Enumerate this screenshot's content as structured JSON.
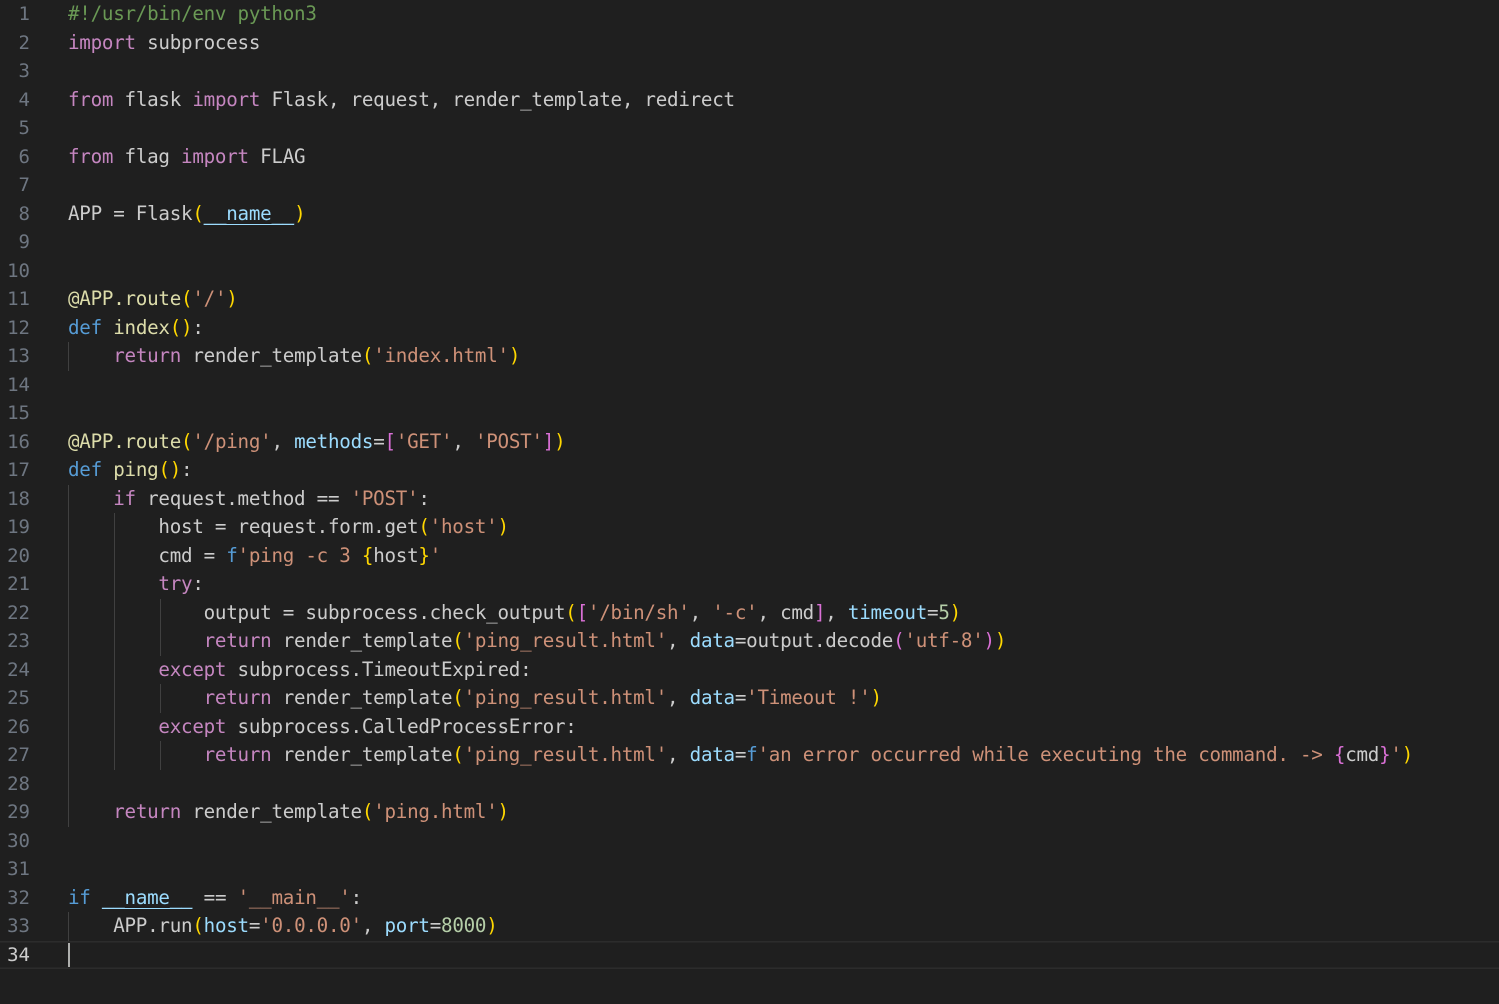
{
  "editor": {
    "language": "python",
    "cursor_line": 34,
    "theme_colors": {
      "background": "#1f1f1f",
      "default_text": "#cccccc",
      "line_number": "#6e7681",
      "comment": "#6a9955",
      "keyword_control": "#c586c0",
      "keyword": "#569cd6",
      "string": "#ce9178",
      "function": "#dcdcaa",
      "variable": "#9cdcfe",
      "number": "#b5cea8",
      "bracket_level_1": "#ffd700",
      "bracket_level_2": "#da70d6",
      "bracket_level_3": "#179fff"
    },
    "lines": [
      {
        "n": "1",
        "indent": 0,
        "tokens": [
          [
            "#!/usr/bin/env python3",
            "cmt"
          ]
        ]
      },
      {
        "n": "2",
        "indent": 0,
        "tokens": [
          [
            "import",
            "kw"
          ],
          [
            " subprocess",
            ""
          ]
        ]
      },
      {
        "n": "3",
        "indent": 0,
        "tokens": []
      },
      {
        "n": "4",
        "indent": 0,
        "tokens": [
          [
            "from",
            "kw"
          ],
          [
            " flask ",
            ""
          ],
          [
            "import",
            "kw"
          ],
          [
            " Flask, request, render_template, redirect",
            ""
          ]
        ]
      },
      {
        "n": "5",
        "indent": 0,
        "tokens": []
      },
      {
        "n": "6",
        "indent": 0,
        "tokens": [
          [
            "from",
            "kw"
          ],
          [
            " flag ",
            ""
          ],
          [
            "import",
            "kw"
          ],
          [
            " FLAG",
            ""
          ]
        ]
      },
      {
        "n": "7",
        "indent": 0,
        "tokens": []
      },
      {
        "n": "8",
        "indent": 0,
        "tokens": [
          [
            "APP = Flask",
            ""
          ],
          [
            "(",
            "b1"
          ],
          [
            "__name__",
            "var ul"
          ],
          [
            ")",
            "b1"
          ]
        ]
      },
      {
        "n": "9",
        "indent": 0,
        "tokens": []
      },
      {
        "n": "10",
        "indent": 0,
        "tokens": []
      },
      {
        "n": "11",
        "indent": 0,
        "tokens": [
          [
            "@APP.route",
            "fn"
          ],
          [
            "(",
            "b1"
          ],
          [
            "'/'",
            "str"
          ],
          [
            ")",
            "b1"
          ]
        ]
      },
      {
        "n": "12",
        "indent": 0,
        "tokens": [
          [
            "def",
            "kwb"
          ],
          [
            " ",
            ""
          ],
          [
            "index",
            "fn"
          ],
          [
            "()",
            "b1"
          ],
          [
            ":",
            ""
          ]
        ]
      },
      {
        "n": "13",
        "indent": 1,
        "tokens": [
          [
            "    ",
            ""
          ],
          [
            "return",
            "kw"
          ],
          [
            " render_template",
            ""
          ],
          [
            "(",
            "b1"
          ],
          [
            "'index.html'",
            "str"
          ],
          [
            ")",
            "b1"
          ]
        ]
      },
      {
        "n": "14",
        "indent": 0,
        "tokens": []
      },
      {
        "n": "15",
        "indent": 0,
        "tokens": []
      },
      {
        "n": "16",
        "indent": 0,
        "tokens": [
          [
            "@APP.route",
            "fn"
          ],
          [
            "(",
            "b1"
          ],
          [
            "'/ping'",
            "str"
          ],
          [
            ", ",
            ""
          ],
          [
            "methods",
            "var"
          ],
          [
            "=",
            ""
          ],
          [
            "[",
            "b2"
          ],
          [
            "'GET'",
            "str"
          ],
          [
            ", ",
            ""
          ],
          [
            "'POST'",
            "str"
          ],
          [
            "]",
            "b2"
          ],
          [
            ")",
            "b1"
          ]
        ]
      },
      {
        "n": "17",
        "indent": 0,
        "tokens": [
          [
            "def",
            "kwb"
          ],
          [
            " ",
            ""
          ],
          [
            "ping",
            "fn"
          ],
          [
            "()",
            "b1"
          ],
          [
            ":",
            ""
          ]
        ]
      },
      {
        "n": "18",
        "indent": 1,
        "tokens": [
          [
            "    ",
            ""
          ],
          [
            "if",
            "kw"
          ],
          [
            " request.method == ",
            ""
          ],
          [
            "'POST'",
            "str"
          ],
          [
            ":",
            ""
          ]
        ]
      },
      {
        "n": "19",
        "indent": 2,
        "tokens": [
          [
            "        host = request.form.get",
            ""
          ],
          [
            "(",
            "b1"
          ],
          [
            "'host'",
            "str"
          ],
          [
            ")",
            "b1"
          ]
        ]
      },
      {
        "n": "20",
        "indent": 2,
        "tokens": [
          [
            "        cmd = ",
            ""
          ],
          [
            "f",
            "kwb"
          ],
          [
            "'ping -c 3 ",
            "str"
          ],
          [
            "{",
            "b1"
          ],
          [
            "host",
            ""
          ],
          [
            "}",
            "b1"
          ],
          [
            "'",
            "str"
          ]
        ]
      },
      {
        "n": "21",
        "indent": 2,
        "tokens": [
          [
            "        ",
            ""
          ],
          [
            "try",
            "kw"
          ],
          [
            ":",
            ""
          ]
        ]
      },
      {
        "n": "22",
        "indent": 3,
        "tokens": [
          [
            "            output = subprocess.check_output",
            ""
          ],
          [
            "(",
            "b1"
          ],
          [
            "[",
            "b2"
          ],
          [
            "'/bin/sh'",
            "str"
          ],
          [
            ", ",
            ""
          ],
          [
            "'-c'",
            "str"
          ],
          [
            ", cmd",
            ""
          ],
          [
            "]",
            "b2"
          ],
          [
            ", ",
            ""
          ],
          [
            "timeout",
            "var"
          ],
          [
            "=",
            ""
          ],
          [
            "5",
            "num"
          ],
          [
            ")",
            "b1"
          ]
        ]
      },
      {
        "n": "23",
        "indent": 3,
        "tokens": [
          [
            "            ",
            ""
          ],
          [
            "return",
            "kw"
          ],
          [
            " render_template",
            ""
          ],
          [
            "(",
            "b1"
          ],
          [
            "'ping_result.html'",
            "str"
          ],
          [
            ", ",
            ""
          ],
          [
            "data",
            "var"
          ],
          [
            "=output.decode",
            ""
          ],
          [
            "(",
            "b2"
          ],
          [
            "'utf-8'",
            "str"
          ],
          [
            ")",
            "b2"
          ],
          [
            ")",
            "b1"
          ]
        ]
      },
      {
        "n": "24",
        "indent": 2,
        "tokens": [
          [
            "        ",
            ""
          ],
          [
            "except",
            "kw"
          ],
          [
            " subprocess.TimeoutExpired:",
            ""
          ]
        ]
      },
      {
        "n": "25",
        "indent": 3,
        "tokens": [
          [
            "            ",
            ""
          ],
          [
            "return",
            "kw"
          ],
          [
            " render_template",
            ""
          ],
          [
            "(",
            "b1"
          ],
          [
            "'ping_result.html'",
            "str"
          ],
          [
            ", ",
            ""
          ],
          [
            "data",
            "var"
          ],
          [
            "=",
            ""
          ],
          [
            "'Timeout !'",
            "str"
          ],
          [
            ")",
            "b1"
          ]
        ]
      },
      {
        "n": "26",
        "indent": 2,
        "tokens": [
          [
            "        ",
            ""
          ],
          [
            "except",
            "kw"
          ],
          [
            " subprocess.CalledProcessError:",
            ""
          ]
        ]
      },
      {
        "n": "27",
        "indent": 3,
        "tokens": [
          [
            "            ",
            ""
          ],
          [
            "return",
            "kw"
          ],
          [
            " render_template",
            ""
          ],
          [
            "(",
            "b1"
          ],
          [
            "'ping_result.html'",
            "str"
          ],
          [
            ", ",
            ""
          ],
          [
            "data",
            "var"
          ],
          [
            "=",
            ""
          ],
          [
            "f",
            "kwb"
          ],
          [
            "'an error occurred while executing the command. -> ",
            "str"
          ],
          [
            "{",
            "b2"
          ],
          [
            "cmd",
            ""
          ],
          [
            "}",
            "b2"
          ],
          [
            "'",
            "str"
          ],
          [
            ")",
            "b1"
          ]
        ]
      },
      {
        "n": "28",
        "indent": 1,
        "tokens": []
      },
      {
        "n": "29",
        "indent": 1,
        "tokens": [
          [
            "    ",
            ""
          ],
          [
            "return",
            "kw"
          ],
          [
            " render_template",
            ""
          ],
          [
            "(",
            "b1"
          ],
          [
            "'ping.html'",
            "str"
          ],
          [
            ")",
            "b1"
          ]
        ]
      },
      {
        "n": "30",
        "indent": 0,
        "tokens": []
      },
      {
        "n": "31",
        "indent": 0,
        "tokens": []
      },
      {
        "n": "32",
        "indent": 0,
        "tokens": [
          [
            "if",
            "kwb"
          ],
          [
            " ",
            ""
          ],
          [
            "__name__",
            "var ul"
          ],
          [
            " == ",
            ""
          ],
          [
            "'__main__'",
            "str"
          ],
          [
            ":",
            ""
          ]
        ]
      },
      {
        "n": "33",
        "indent": 1,
        "tokens": [
          [
            "    APP.run",
            ""
          ],
          [
            "(",
            "b1"
          ],
          [
            "host",
            "var"
          ],
          [
            "=",
            ""
          ],
          [
            "'0.0.0.0'",
            "str"
          ],
          [
            ", ",
            ""
          ],
          [
            "port",
            "var"
          ],
          [
            "=",
            ""
          ],
          [
            "8000",
            "num"
          ],
          [
            ")",
            "b1"
          ]
        ]
      },
      {
        "n": "34",
        "indent": 0,
        "tokens": []
      }
    ]
  }
}
